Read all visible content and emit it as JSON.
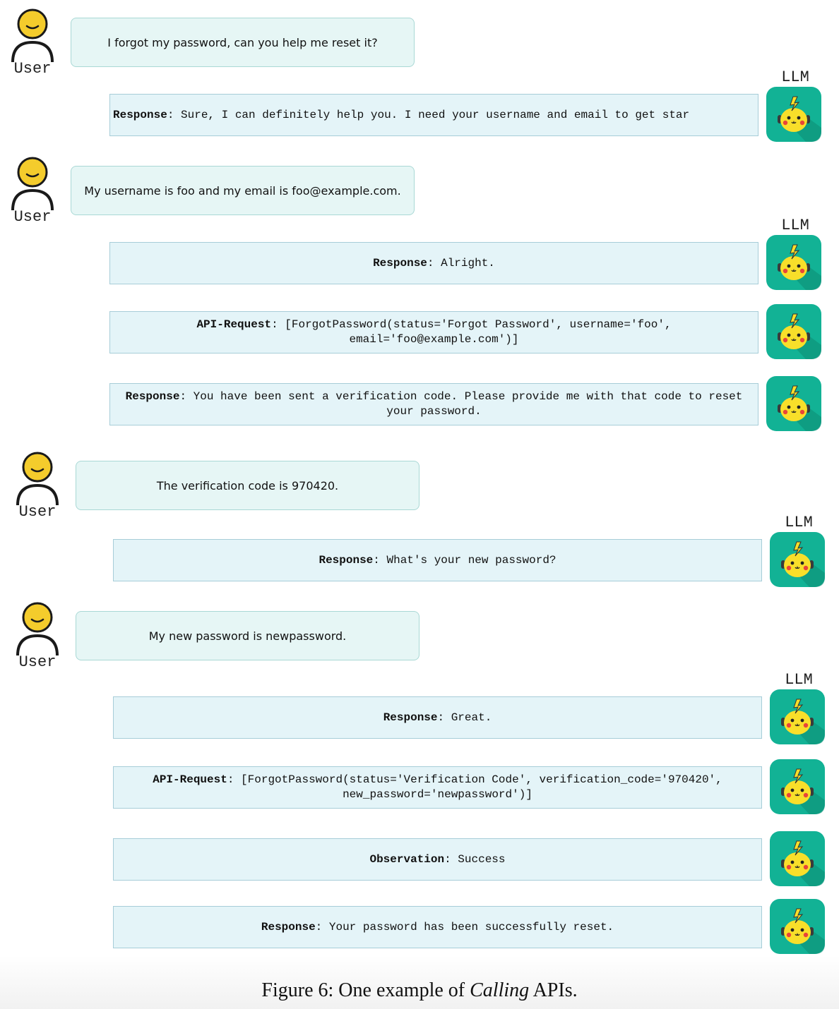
{
  "labels": {
    "user": "User",
    "llm": "LLM"
  },
  "messages": {
    "u1": "I forgot my password, can you help me reset it?",
    "r1_label": "Response",
    "r1": "Sure, I can definitely help you. I need your username and email to get star",
    "u2": "My username is foo and my email is foo@example.com.",
    "r2_label": "Response",
    "r2": "Alright.",
    "a1_label": "API-Request",
    "a1": "[ForgotPassword(status='Forgot Password', username='foo', email='foo@example.com')]",
    "r3_label": "Response",
    "r3": "You have been sent a verification code. Please provide me with that code to reset your password.",
    "u3": "The verification code is 970420.",
    "r4_label": "Response",
    "r4": "What's your new password?",
    "u4": "My new password is newpassword.",
    "r5_label": "Response",
    "r5": "Great.",
    "a2_label": "API-Request",
    "a2": "[ForgotPassword(status='Verification Code', verification_code='970420', new_password='newpassword')]",
    "o1_label": "Observation",
    "o1": "Success",
    "r6_label": "Response",
    "r6": "Your password has been successfully reset."
  },
  "caption": {
    "prefix": "Figure 6: One example of ",
    "italic": "Calling",
    "suffix": " APIs."
  },
  "colors": {
    "user_face": "#f4cc2c",
    "llm_bg": "#12b295",
    "user_bubble": "#e6f6f5",
    "llm_box": "#e4f4f8"
  },
  "icons": {
    "user": "user-person-icon",
    "llm": "pikachu-avatar-icon"
  }
}
